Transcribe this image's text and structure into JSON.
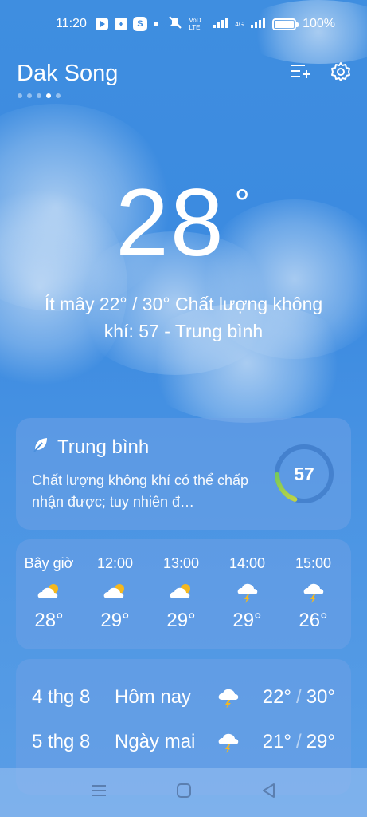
{
  "status_bar": {
    "time": "11:20",
    "app_icons": [
      "play-icon",
      "messenger-icon",
      "shopee-icon"
    ],
    "shopee_glyph": "S",
    "network_label": "VoD LTE",
    "signal_label": "4G",
    "battery_text": "100%",
    "battery_level": 1.0
  },
  "header": {
    "city": "Dak Song",
    "page_count": 5,
    "active_page": 3
  },
  "current": {
    "temperature": "28",
    "degree_symbol": "°",
    "summary": "Ít mây  22° / 30°  Chất lượng không khí: 57 - Trung bình"
  },
  "air_quality": {
    "title": "Trung bình",
    "description": "Chất lượng không khí có thể chấp nhận được; tuy nhiên đ…",
    "value": "57",
    "level": 0.19,
    "gauge_color_start": "#3ac26a",
    "gauge_color_end": "#e8d83a"
  },
  "hourly": [
    {
      "time": "Bây giờ",
      "icon": "partly-cloudy-icon",
      "temp": "28°"
    },
    {
      "time": "12:00",
      "icon": "partly-cloudy-icon",
      "temp": "29°"
    },
    {
      "time": "13:00",
      "icon": "partly-cloudy-icon",
      "temp": "29°"
    },
    {
      "time": "14:00",
      "icon": "thunderstorm-icon",
      "temp": "29°"
    },
    {
      "time": "15:00",
      "icon": "thunderstorm-icon",
      "temp": "26°"
    }
  ],
  "daily": [
    {
      "date": "4 thg 8",
      "name": "Hôm nay",
      "icon": "thunderstorm-icon",
      "low": "22°",
      "high": "30°"
    },
    {
      "date": "5 thg 8",
      "name": "Ngày mai",
      "icon": "thunderstorm-icon",
      "low": "21°",
      "high": "29°"
    }
  ],
  "colors": {
    "sky": "#3f8ee0",
    "card": "#6ea0e6",
    "sun": "#f5b81e"
  }
}
